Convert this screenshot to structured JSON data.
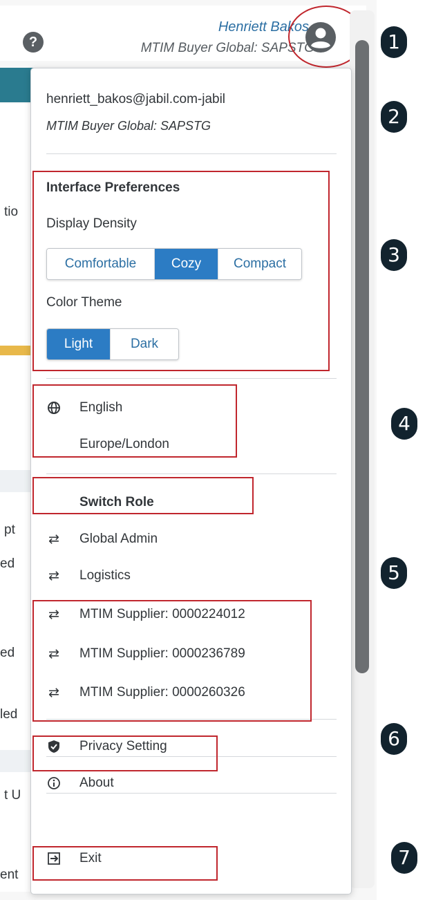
{
  "header": {
    "user_name": "Henriett Bakos",
    "user_role": "MTIM Buyer Global: SAPSTG"
  },
  "background_fragments": [
    "tio",
    "pt",
    "ed",
    "ed",
    "led",
    "t U",
    "ent"
  ],
  "menu": {
    "email": "henriett_bakos@jabil.com-jabil",
    "role": "MTIM Buyer Global: SAPSTG",
    "interface_preferences": {
      "title": "Interface Preferences",
      "density_label": "Display Density",
      "density_options": [
        "Comfortable",
        "Cozy",
        "Compact"
      ],
      "density_selected": "Cozy",
      "theme_label": "Color Theme",
      "theme_options": [
        "Light",
        "Dark"
      ],
      "theme_selected": "Light"
    },
    "locale": {
      "language": "English",
      "timezone": "Europe/London"
    },
    "switch_role": {
      "title": "Switch Role",
      "roles": [
        "Global Admin",
        "Logistics",
        "MTIM Supplier: 0000224012",
        "MTIM Supplier: 0000236789",
        "MTIM Supplier: 0000260326"
      ]
    },
    "privacy_label": "Privacy Setting",
    "about_label": "About",
    "exit_label": "Exit"
  },
  "annotations": [
    "1",
    "2",
    "3",
    "4",
    "5",
    "6",
    "7"
  ],
  "colors": {
    "accent": "#2c7cc4",
    "annotation_red": "#c0262d",
    "badge_bg": "#12232e",
    "name_blue": "#2c6fa3"
  }
}
